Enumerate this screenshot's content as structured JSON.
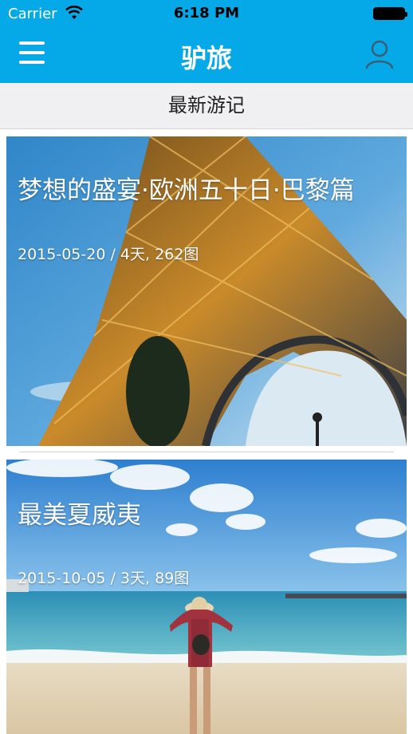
{
  "status_bar": {
    "carrier": "Carrier",
    "time": "6:18 PM"
  },
  "navbar": {
    "title": "驴旅",
    "menu_icon": "hamburger-menu-icon",
    "user_icon": "user-profile-icon",
    "background_color": "#06a9e7"
  },
  "section": {
    "title": "最新游记"
  },
  "posts": [
    {
      "title": "梦想的盛宴·欧洲五十日·巴黎篇",
      "meta": "2015-05-20 / 4天, 262图",
      "image": "eiffel-tower-photo"
    },
    {
      "title": "最美夏威夷",
      "meta": "2015-10-05 / 3天, 89图",
      "image": "hawaii-beach-photo"
    }
  ]
}
